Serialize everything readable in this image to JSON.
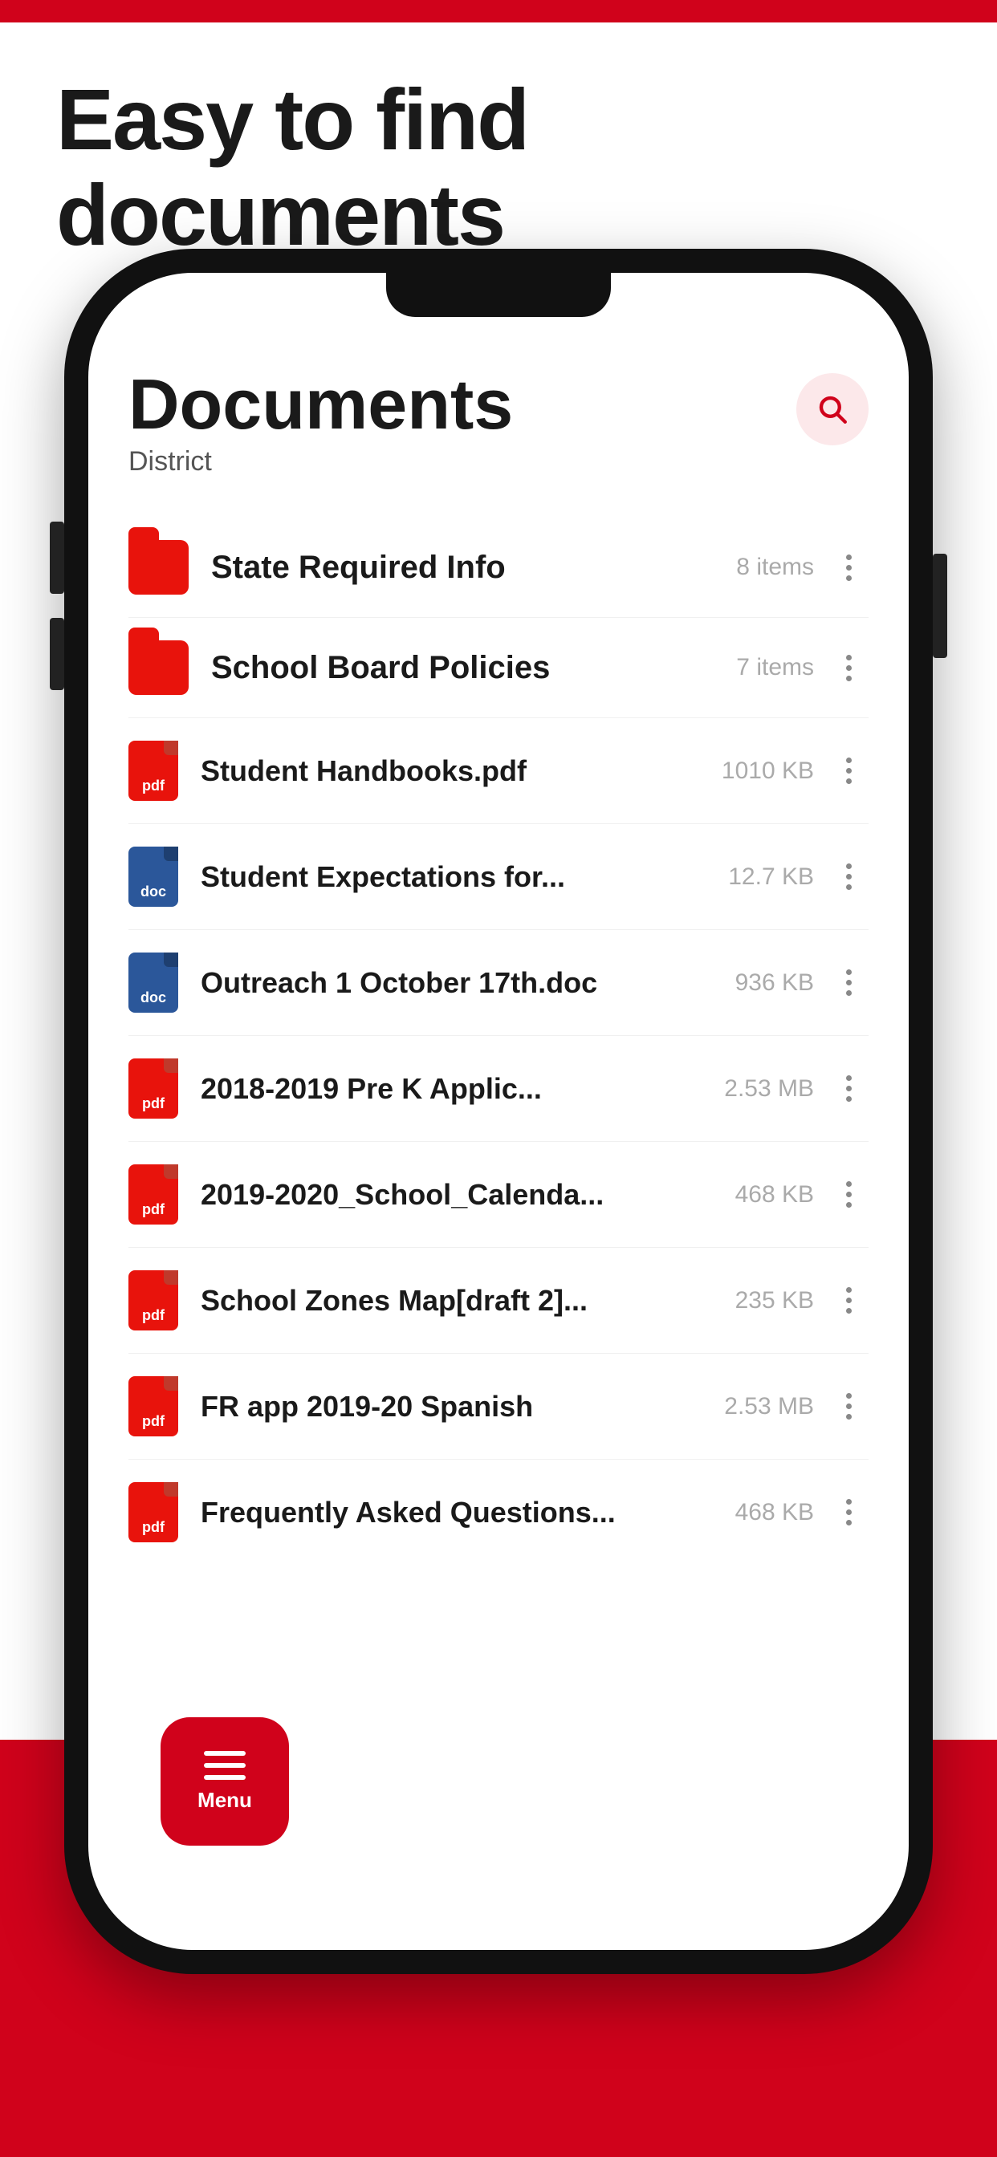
{
  "page": {
    "headline": "Easy to find documents",
    "bg_top_color": "#D0021B",
    "bg_bottom_color": "#D0021B"
  },
  "screen": {
    "title": "Documents",
    "subtitle": "District",
    "search_icon": "search"
  },
  "items": [
    {
      "id": 1,
      "type": "folder",
      "name": "State Required Info",
      "meta": "8 items",
      "icon_type": "folder"
    },
    {
      "id": 2,
      "type": "folder",
      "name": "School Board Policies",
      "meta": "7 items",
      "icon_type": "folder"
    },
    {
      "id": 3,
      "type": "pdf",
      "name": "Student Handbooks.pdf",
      "meta": "1010 KB",
      "icon_type": "pdf"
    },
    {
      "id": 4,
      "type": "doc",
      "name": "Student Expectations for...",
      "meta": "12.7 KB",
      "icon_type": "doc"
    },
    {
      "id": 5,
      "type": "doc",
      "name": "Outreach 1 October 17th.doc",
      "meta": "936 KB",
      "icon_type": "doc"
    },
    {
      "id": 6,
      "type": "pdf",
      "name": "2018-2019 Pre K Applic...",
      "meta": "2.53 MB",
      "icon_type": "pdf"
    },
    {
      "id": 7,
      "type": "pdf",
      "name": "2019-2020_School_Calenda...",
      "meta": "468 KB",
      "icon_type": "pdf"
    },
    {
      "id": 8,
      "type": "pdf",
      "name": "School Zones Map[draft 2]...",
      "meta": "235 KB",
      "icon_type": "pdf"
    },
    {
      "id": 9,
      "type": "pdf",
      "name": "FR app 2019-20 Spanish",
      "meta": "2.53 MB",
      "icon_type": "pdf"
    },
    {
      "id": 10,
      "type": "pdf",
      "name": "Frequently Asked Questions...",
      "meta": "468 KB",
      "icon_type": "pdf"
    }
  ],
  "menu": {
    "label": "Menu"
  }
}
